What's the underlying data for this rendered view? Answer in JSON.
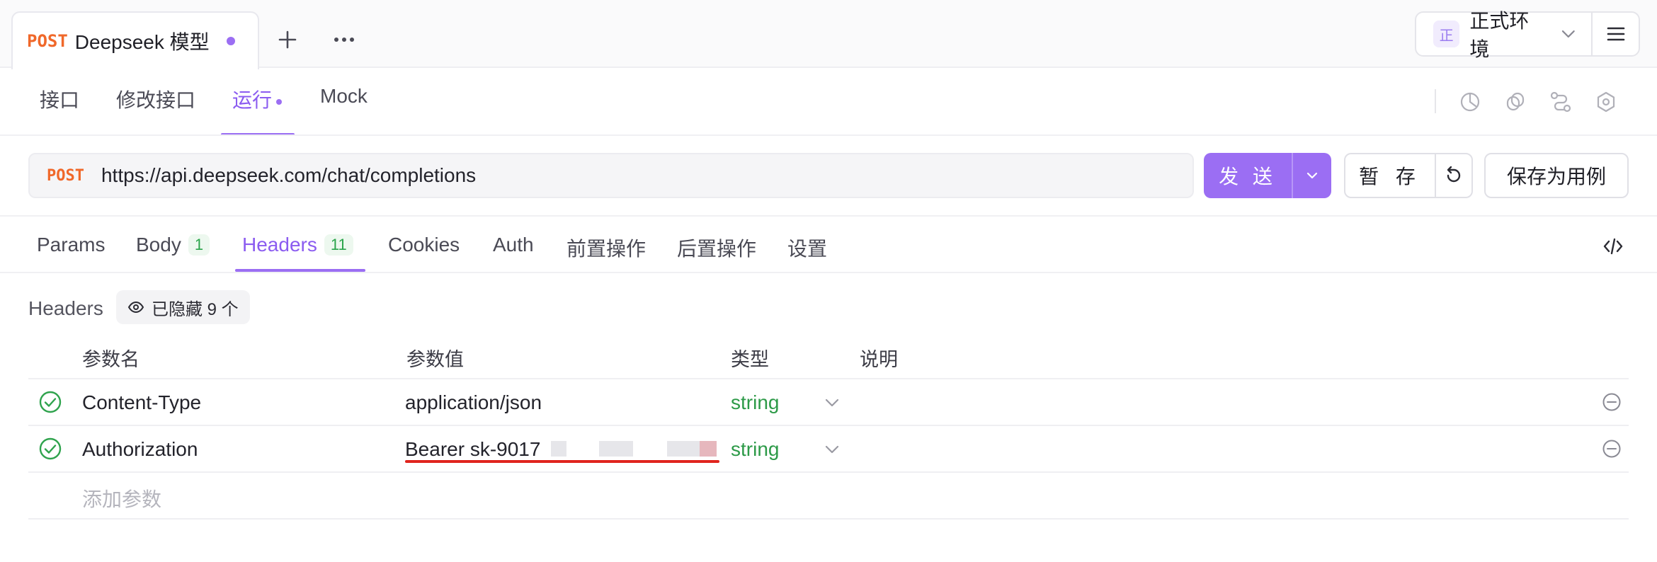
{
  "tab": {
    "method": "POST",
    "name": "Deepseek 模型"
  },
  "environment": {
    "badge": "正",
    "label": "正式环境"
  },
  "nav": {
    "items": [
      "接口",
      "修改接口",
      "运行",
      "Mock"
    ],
    "active": "运行"
  },
  "request": {
    "method": "POST",
    "url": "https://api.deepseek.com/chat/completions",
    "send_label": "发 送",
    "draft_label": "暂 存",
    "save_as_label": "保存为用例"
  },
  "subtabs": {
    "params": "Params",
    "body": "Body",
    "body_count": "1",
    "headers": "Headers",
    "headers_count": "11",
    "cookies": "Cookies",
    "auth": "Auth",
    "pre": "前置操作",
    "post": "后置操作",
    "settings": "设置"
  },
  "headers_section": {
    "title": "Headers",
    "hidden_label": "已隐藏 9 个",
    "columns": {
      "name": "参数名",
      "value": "参数值",
      "type": "类型",
      "desc": "说明"
    },
    "rows": [
      {
        "name": "Content-Type",
        "value": "application/json",
        "type": "string"
      },
      {
        "name": "Authorization",
        "value": "Bearer sk-9017",
        "type": "string"
      }
    ],
    "add_placeholder": "添加参数"
  },
  "colors": {
    "accent": "#9b6ef3",
    "method": "#f0682a",
    "type_green": "#2d9a48",
    "underline_red": "#e0241e"
  }
}
